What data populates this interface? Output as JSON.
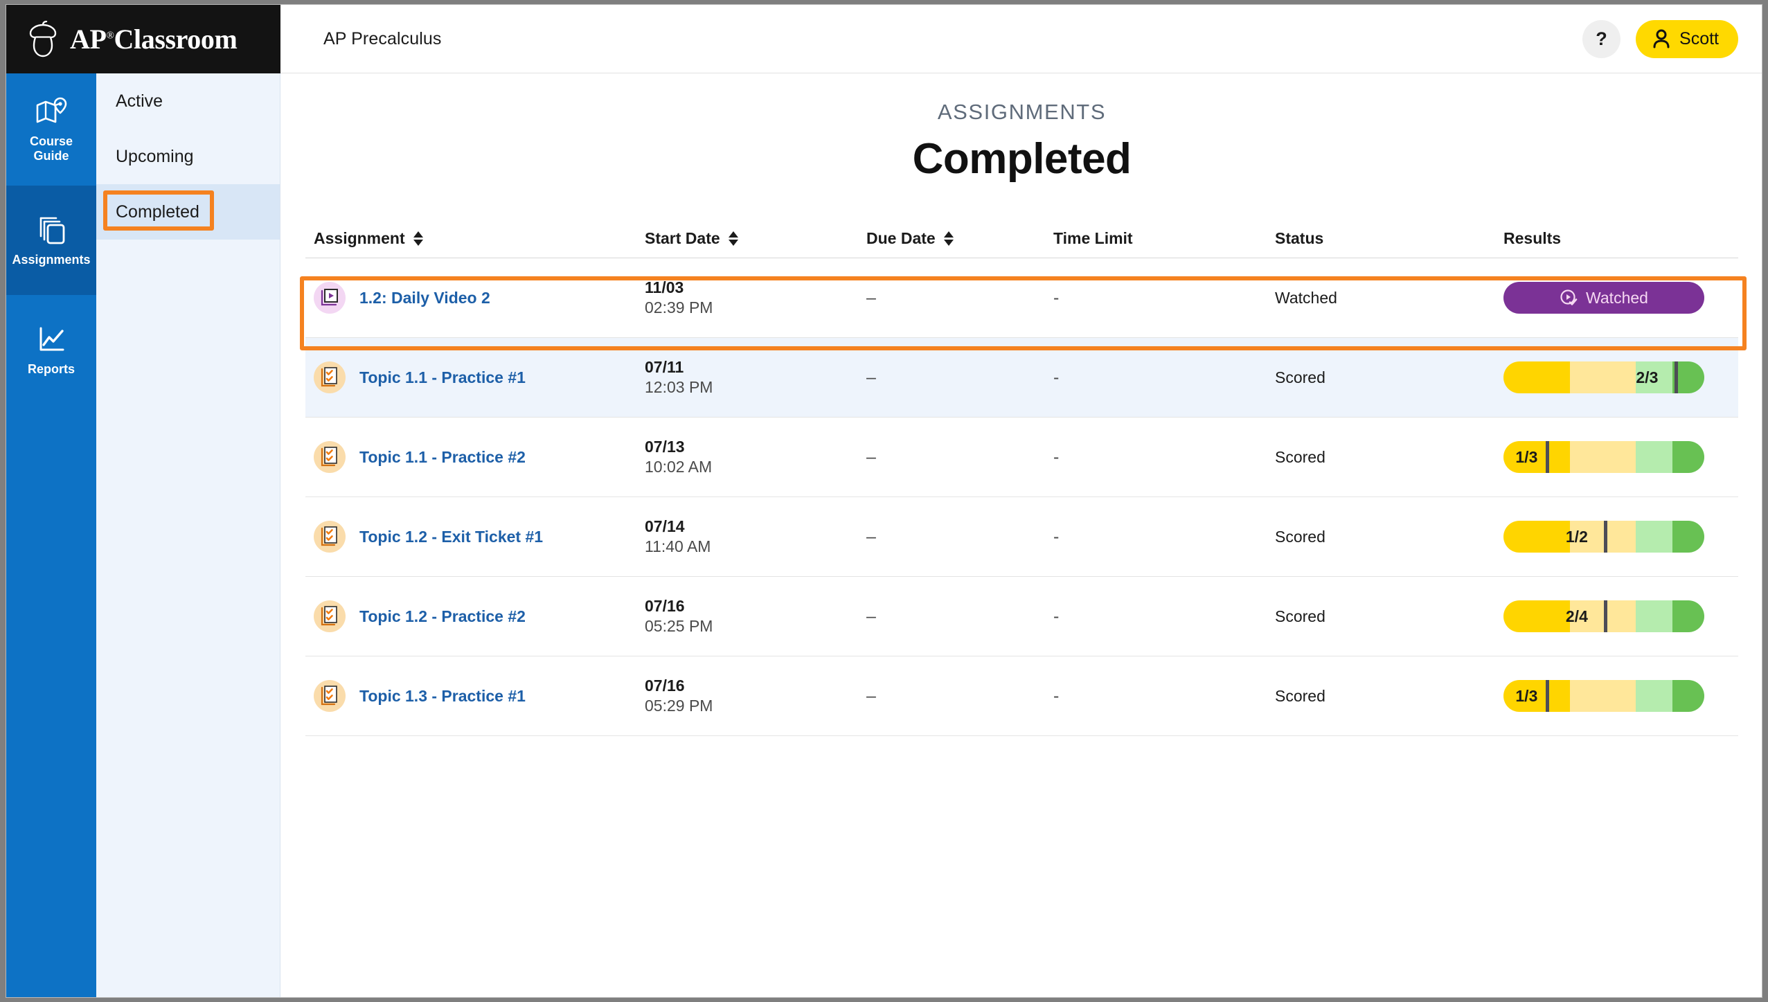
{
  "brand": {
    "name": "AP Classroom",
    "ap": "AP",
    "registered": "®",
    "word": "Classroom",
    "acorn_icon": "acorn-icon"
  },
  "header": {
    "course_title": "AP Precalculus",
    "help_label": "?",
    "user_name": "Scott",
    "user_icon": "person-icon"
  },
  "rail": {
    "items": [
      {
        "label": "Course\nGuide",
        "line1": "Course",
        "line2": "Guide",
        "icon": "map-pin-icon",
        "active": false
      },
      {
        "label": "Assignments",
        "line1": "Assignments",
        "line2": "",
        "icon": "stacked-pages-icon",
        "active": true
      },
      {
        "label": "Reports",
        "line1": "Reports",
        "line2": "",
        "icon": "line-chart-icon",
        "active": false
      }
    ]
  },
  "subnav": {
    "items": [
      {
        "label": "Active",
        "active": false
      },
      {
        "label": "Upcoming",
        "active": false
      },
      {
        "label": "Completed",
        "active": true
      }
    ]
  },
  "page": {
    "eyebrow": "ASSIGNMENTS",
    "title": "Completed"
  },
  "table": {
    "columns": [
      {
        "label": "Assignment",
        "sortable": true
      },
      {
        "label": "Start Date",
        "sortable": true
      },
      {
        "label": "Due Date",
        "sortable": true
      },
      {
        "label": "Time Limit",
        "sortable": false
      },
      {
        "label": "Status",
        "sortable": false
      },
      {
        "label": "Results",
        "sortable": false
      }
    ],
    "rows": [
      {
        "name": "1.2: Daily Video 2",
        "icon": "video-play-icon",
        "icon_kind": "video",
        "start_date": "11/03",
        "start_time": "02:39 PM",
        "due_date": "–",
        "time_limit": "-",
        "status": "Watched",
        "result_kind": "watched",
        "result_label": "Watched",
        "result_icon": "play-circle-check-icon"
      },
      {
        "name": "Topic 1.1 - Practice #1",
        "icon": "checklist-icon",
        "icon_kind": "practice",
        "start_date": "07/11",
        "start_time": "12:03 PM",
        "due_date": "–",
        "time_limit": "-",
        "status": "Scored",
        "result_kind": "score",
        "result_label": "2/3",
        "score_fill_pct": 66,
        "marker_pct": 85
      },
      {
        "name": "Topic 1.1 - Practice #2",
        "icon": "checklist-icon",
        "icon_kind": "practice",
        "start_date": "07/13",
        "start_time": "10:02 AM",
        "due_date": "–",
        "time_limit": "-",
        "status": "Scored",
        "result_kind": "score",
        "result_label": "1/3",
        "score_fill_pct": 33,
        "marker_pct": 21
      },
      {
        "name": "Topic 1.2 - Exit Ticket #1",
        "icon": "checklist-icon",
        "icon_kind": "practice",
        "start_date": "07/14",
        "start_time": "11:40 AM",
        "due_date": "–",
        "time_limit": "-",
        "status": "Scored",
        "result_kind": "score",
        "result_label": "1/2",
        "score_fill_pct": 50,
        "marker_pct": 50
      },
      {
        "name": "Topic 1.2 - Practice #2",
        "icon": "checklist-icon",
        "icon_kind": "practice",
        "start_date": "07/16",
        "start_time": "05:25 PM",
        "due_date": "–",
        "time_limit": "-",
        "status": "Scored",
        "result_kind": "score",
        "result_label": "2/4",
        "score_fill_pct": 50,
        "marker_pct": 50
      },
      {
        "name": "Topic 1.3 - Practice #1",
        "icon": "checklist-icon",
        "icon_kind": "practice",
        "start_date": "07/16",
        "start_time": "05:29 PM",
        "due_date": "–",
        "time_limit": "-",
        "status": "Scored",
        "result_kind": "score",
        "result_label": "1/3",
        "score_fill_pct": 33,
        "marker_pct": 21
      }
    ]
  },
  "annotations": {
    "highlight_color": "#f58220",
    "targets": [
      "Completed",
      "1.2: Daily Video 2"
    ]
  },
  "colors": {
    "brand_black": "#131313",
    "rail_blue": "#0d72c5",
    "rail_blue_active": "#0a5ca5",
    "subnav_bg": "#eef4fc",
    "accent_yellow": "#ffd900",
    "link_blue": "#1d5fa8",
    "purple": "#7b3296"
  }
}
